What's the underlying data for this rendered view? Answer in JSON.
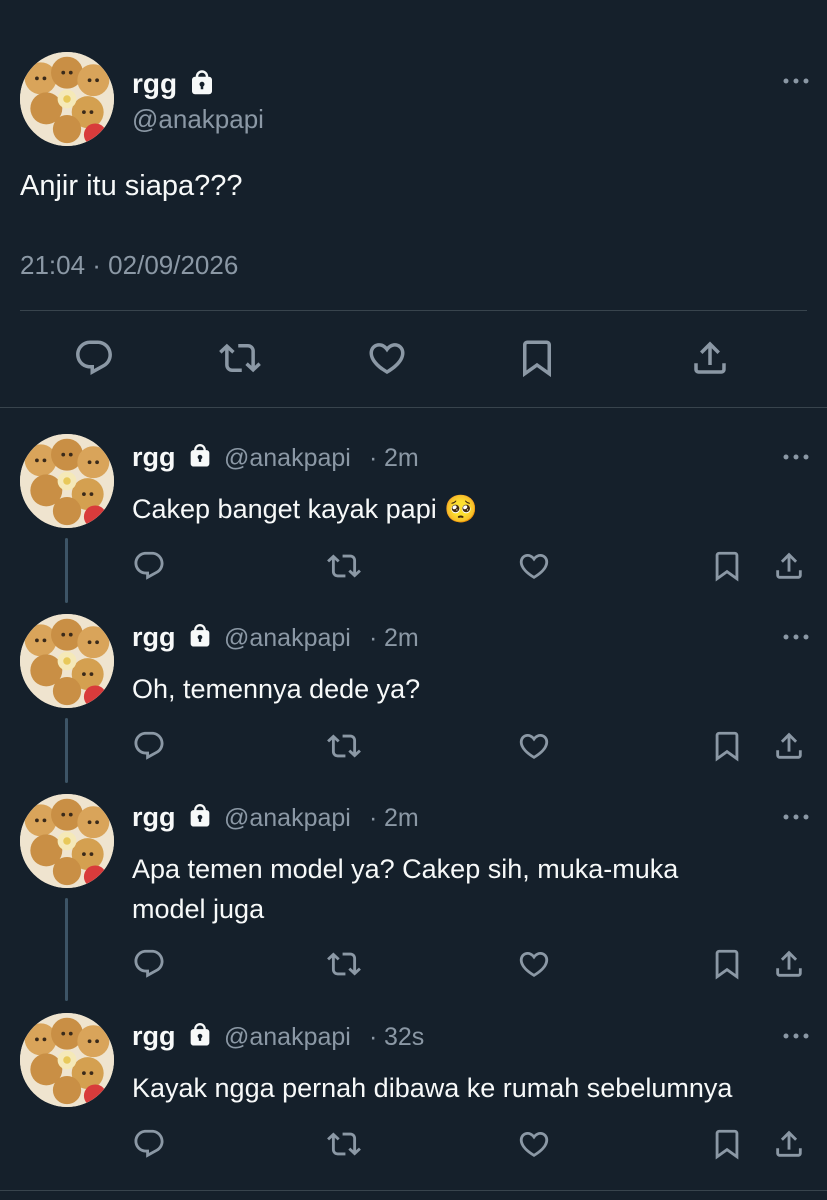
{
  "colors": {
    "background": "#15202b",
    "text": "#f7f9f9",
    "muted": "#8b98a5",
    "divider": "#38444d",
    "thread_line": "#3d5466"
  },
  "main_tweet": {
    "display_name": "rgg",
    "handle": "@anakpapi",
    "text": "Anjir itu siapa???",
    "timestamp": "21:04 · 02/09/2026",
    "actions": [
      "reply-icon",
      "retweet-icon",
      "like-icon",
      "bookmark-icon",
      "share-icon"
    ]
  },
  "replies": [
    {
      "display_name": "rgg",
      "handle": "@anakpapi",
      "time": "2m",
      "text": "Cakep banget kayak papi 🥺"
    },
    {
      "display_name": "rgg",
      "handle": "@anakpapi",
      "time": "2m",
      "text": "Oh, temennya dede ya?"
    },
    {
      "display_name": "rgg",
      "handle": "@anakpapi",
      "time": "2m",
      "text_line1": "Apa temen model ya? Cakep sih, muka-muka",
      "text_line2": "model juga"
    },
    {
      "display_name": "rgg",
      "handle": "@anakpapi",
      "time": "32s",
      "text": "Kayak ngga pernah dibawa ke rumah sebelumnya"
    }
  ],
  "meta_sep": "·"
}
